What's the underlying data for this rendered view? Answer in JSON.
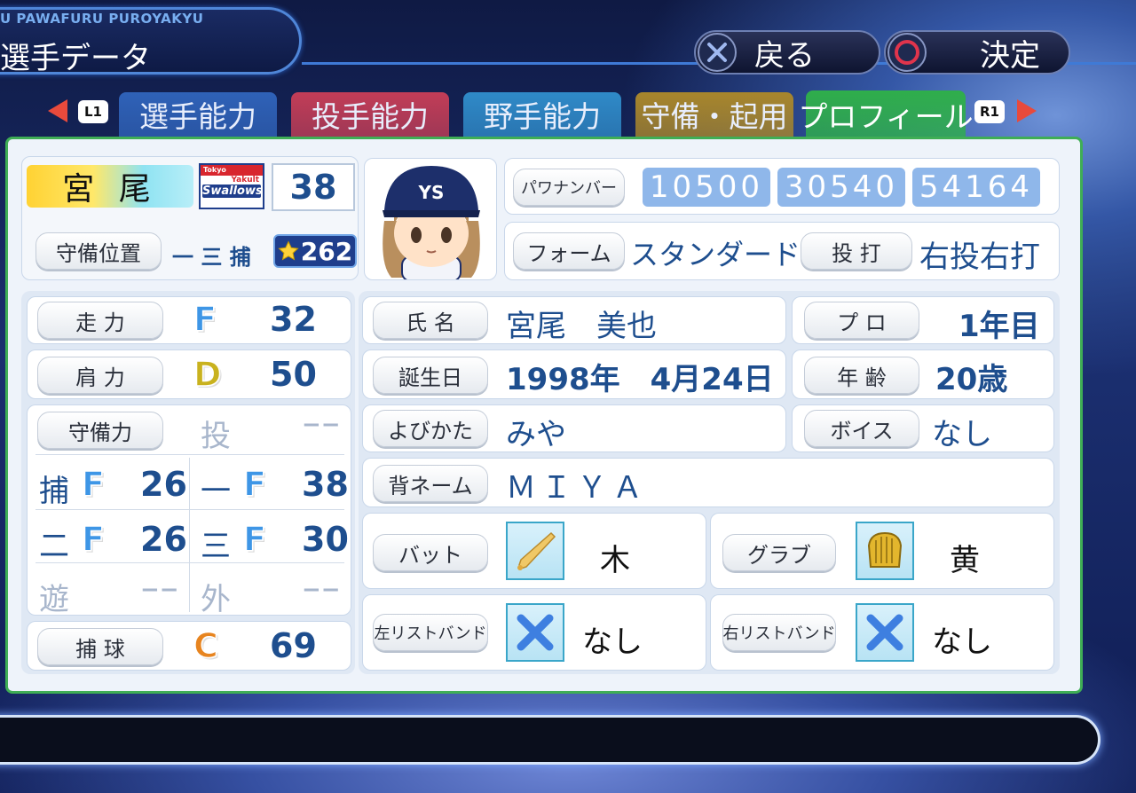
{
  "header": {
    "brand": "U PAWAFURU PUROYAKYU",
    "title": "選手データ",
    "back_label": "戻る",
    "confirm_label": "決定"
  },
  "tabs": {
    "l1": "L1",
    "r1": "R1",
    "items": [
      {
        "label": "選手能力",
        "color": "#2f62b8"
      },
      {
        "label": "投手能力",
        "color": "#c23d57"
      },
      {
        "label": "野手能力",
        "color": "#2f8ac8"
      },
      {
        "label": "守備・起用",
        "color": "#a8862c"
      },
      {
        "label": "プロフィール",
        "color": "#2fae4b"
      }
    ]
  },
  "player": {
    "name": "宮 尾",
    "number": "38",
    "team_logo_top": "Tokyo",
    "team_logo_mid": "Yakult",
    "team_logo_main": "Swallows",
    "position_label": "守備位置",
    "positions": "一 三 捕",
    "star_value": "262"
  },
  "powanumber": {
    "label": "パワナンバー",
    "values": [
      "10500",
      "30540",
      "54164"
    ]
  },
  "form": {
    "label": "フォーム",
    "value": "スタンダード１",
    "throw_bat_label": "投 打",
    "throw_bat_value": "右投右打"
  },
  "abilities": {
    "run": {
      "label": "走 力",
      "grade": "F",
      "value": "32"
    },
    "arm": {
      "label": "肩 力",
      "grade": "D",
      "value": "50"
    },
    "defense_label": "守備力",
    "pitcher": {
      "pos": "投",
      "value": "−−"
    },
    "catcher": {
      "pos": "捕",
      "grade": "F",
      "value": "26"
    },
    "first": {
      "pos": "一",
      "grade": "F",
      "value": "38"
    },
    "second": {
      "pos": "二",
      "grade": "F",
      "value": "26"
    },
    "third": {
      "pos": "三",
      "grade": "F",
      "value": "30"
    },
    "short": {
      "pos": "遊",
      "value": "−−"
    },
    "outfield": {
      "pos": "外",
      "value": "−−"
    },
    "catching": {
      "label": "捕 球",
      "grade": "C",
      "value": "69"
    }
  },
  "profile": {
    "name_label": "氏 名",
    "name_value": "宮尾　美也",
    "birthday_label": "誕生日",
    "birthday_value": "1998年　4月24日",
    "reading_label": "よびかた",
    "reading_value": "みや",
    "back_name_label": "背ネーム",
    "back_name_value": "ＭＩＹＡ",
    "pro_label": "プ ロ",
    "pro_value": "1年目",
    "age_label": "年 齢",
    "age_value": "20歳",
    "voice_label": "ボイス",
    "voice_value": "なし",
    "bat_label": "バット",
    "bat_value": "木",
    "glove_label": "グラブ",
    "glove_value": "黄",
    "left_wrist_label": "左リストバンド",
    "left_wrist_value": "なし",
    "right_wrist_label": "右リストバンド",
    "right_wrist_value": "なし"
  }
}
